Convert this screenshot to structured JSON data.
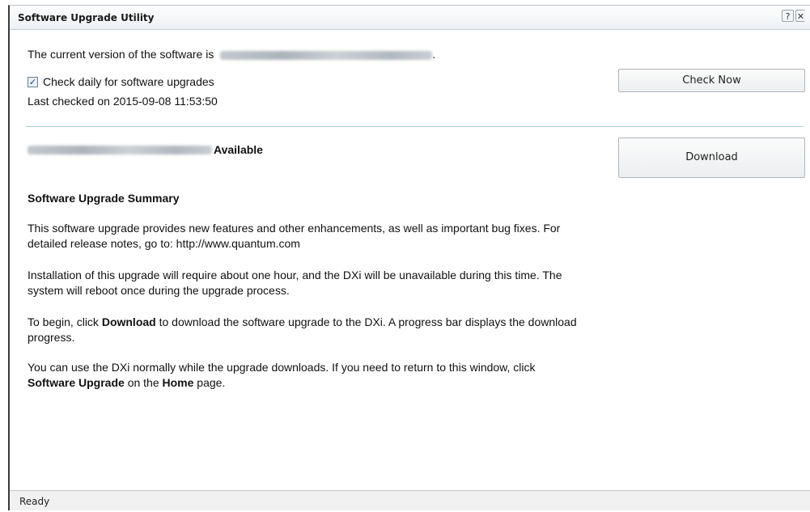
{
  "window": {
    "title": "Software Upgrade Utility",
    "help_label": "?",
    "close_label": "✕"
  },
  "current_version": {
    "prefix": "The current version of the software is",
    "suffix": "."
  },
  "auto_check": {
    "label": "Check daily for software upgrades",
    "checked": true,
    "check_glyph": "✓"
  },
  "last_checked": "Last checked on 2015-09-08 11:53:50",
  "check_now_button": "Check Now",
  "available": {
    "status": "Available"
  },
  "download_button": "Download",
  "summary": {
    "heading": "Software Upgrade Summary",
    "p1": "This software upgrade provides new features and other enhancements, as well as important bug fixes. For detailed release notes, go to: http://www.quantum.com",
    "p2": "Installation of this upgrade will require about one hour, and the DXi will be unavailable during this time. The system will reboot once during the upgrade process.",
    "p3": {
      "before": "To begin, click ",
      "bold1": "Download",
      "after": " to download the software upgrade to the DXi. A progress bar displays the download progress."
    },
    "p4": {
      "before": "You can use the DXi normally while the upgrade downloads. If you need to return to this window, click ",
      "bold1": "Software Upgrade",
      "middle": " on the ",
      "bold2": "Home",
      "after": " page."
    }
  },
  "statusbar": {
    "text": "Ready"
  },
  "colors": {
    "divider": "#a9cfd9",
    "window_border": "#3a3a3a"
  }
}
